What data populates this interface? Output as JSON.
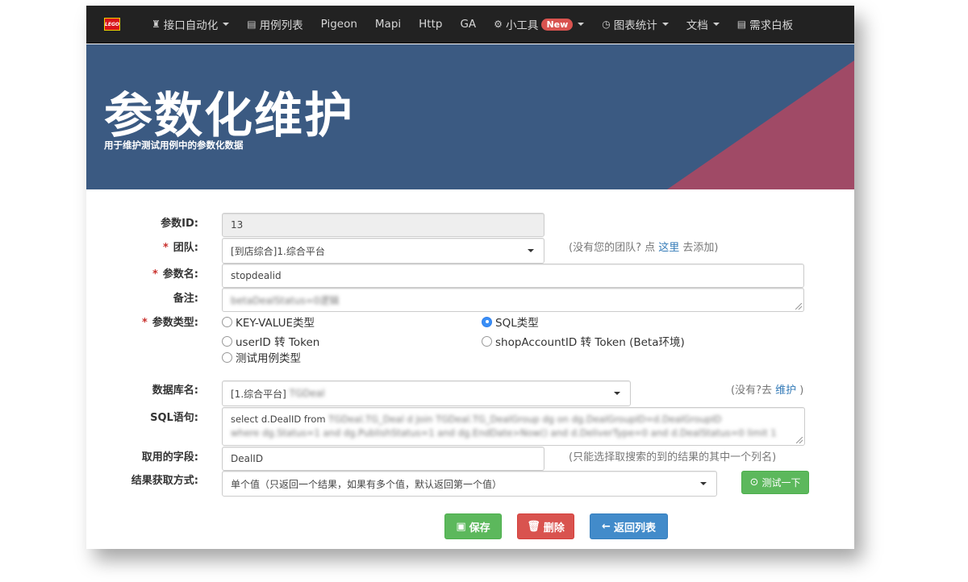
{
  "nav": {
    "logo_text": "LEGO",
    "items": [
      {
        "icon": "trophy-icon",
        "glyph": "♜",
        "label": "接口自动化",
        "caret": true
      },
      {
        "icon": "list-icon",
        "glyph": "▤",
        "label": "用例列表",
        "caret": false
      },
      {
        "icon": "",
        "glyph": "",
        "label": "Pigeon",
        "caret": false
      },
      {
        "icon": "",
        "glyph": "",
        "label": "Mapi",
        "caret": false
      },
      {
        "icon": "",
        "glyph": "",
        "label": "Http",
        "caret": false
      },
      {
        "icon": "",
        "glyph": "",
        "label": "GA",
        "caret": false
      },
      {
        "icon": "gear-icon",
        "glyph": "⚙",
        "label": "小工具",
        "caret": true,
        "badge": "New"
      },
      {
        "icon": "clock-icon",
        "glyph": "◷",
        "label": "图表统计",
        "caret": true
      },
      {
        "icon": "",
        "glyph": "",
        "label": "文档",
        "caret": true
      },
      {
        "icon": "board-icon",
        "glyph": "▤",
        "label": "需求白板",
        "caret": false
      }
    ]
  },
  "hero": {
    "title": "参数化维护",
    "subtitle": "用于维护测试用例中的参数化数据",
    "bg_color": "#3b5a82",
    "accent_color": "#a04a66"
  },
  "form": {
    "param_id": {
      "label": "参数ID:",
      "value": "13"
    },
    "team": {
      "label": "团队:",
      "value": "[到店综合]1.综合平台",
      "hint_prefix": "(没有您的团队? 点 ",
      "hint_link": "这里",
      "hint_suffix": " 去添加)"
    },
    "param_name": {
      "label": "参数名:",
      "value": "stopdealid"
    },
    "note": {
      "label": "备注:",
      "value": "betaDealStatus=0逻辑"
    },
    "param_type": {
      "label": "参数类型:",
      "options": [
        "KEY-VALUE类型",
        "SQL类型",
        "userID 转 Token",
        "shopAccountID 转 Token (Beta环境)",
        "测试用例类型"
      ],
      "selected": "SQL类型"
    },
    "database": {
      "label": "数据库名:",
      "value_prefix": "[1.综合平台]",
      "value_blur": "TGDeal",
      "hint_prefix": "(没有?去 ",
      "hint_link": "维护",
      "hint_suffix": " )"
    },
    "sql": {
      "label": "SQL语句:",
      "line1_prefix": "select d.DealID from",
      "line1_blur": "TGDeal.TG_Deal d Join TGDeal.TG_DealGroup dg on dg.DealGroupID=d.DealGroupID",
      "line2_blur": "where dg.Status=1 and dg.PublishStatus=1 and dg.EndDate>Now() and d.DeliverType=0 and d.DealStatus=0 limit 1"
    },
    "field": {
      "label": "取用的字段:",
      "value": "DealID",
      "hint": "(只能选择取搜索的到的结果的其中一个列名)"
    },
    "fetch_mode": {
      "label": "结果获取方式:",
      "value": "单个值（只返回一个结果，如果有多个值，默认返回第一个值）"
    },
    "test_button": "测试一下"
  },
  "actions": {
    "save": "保存",
    "delete": "删除",
    "back": "返回列表"
  }
}
